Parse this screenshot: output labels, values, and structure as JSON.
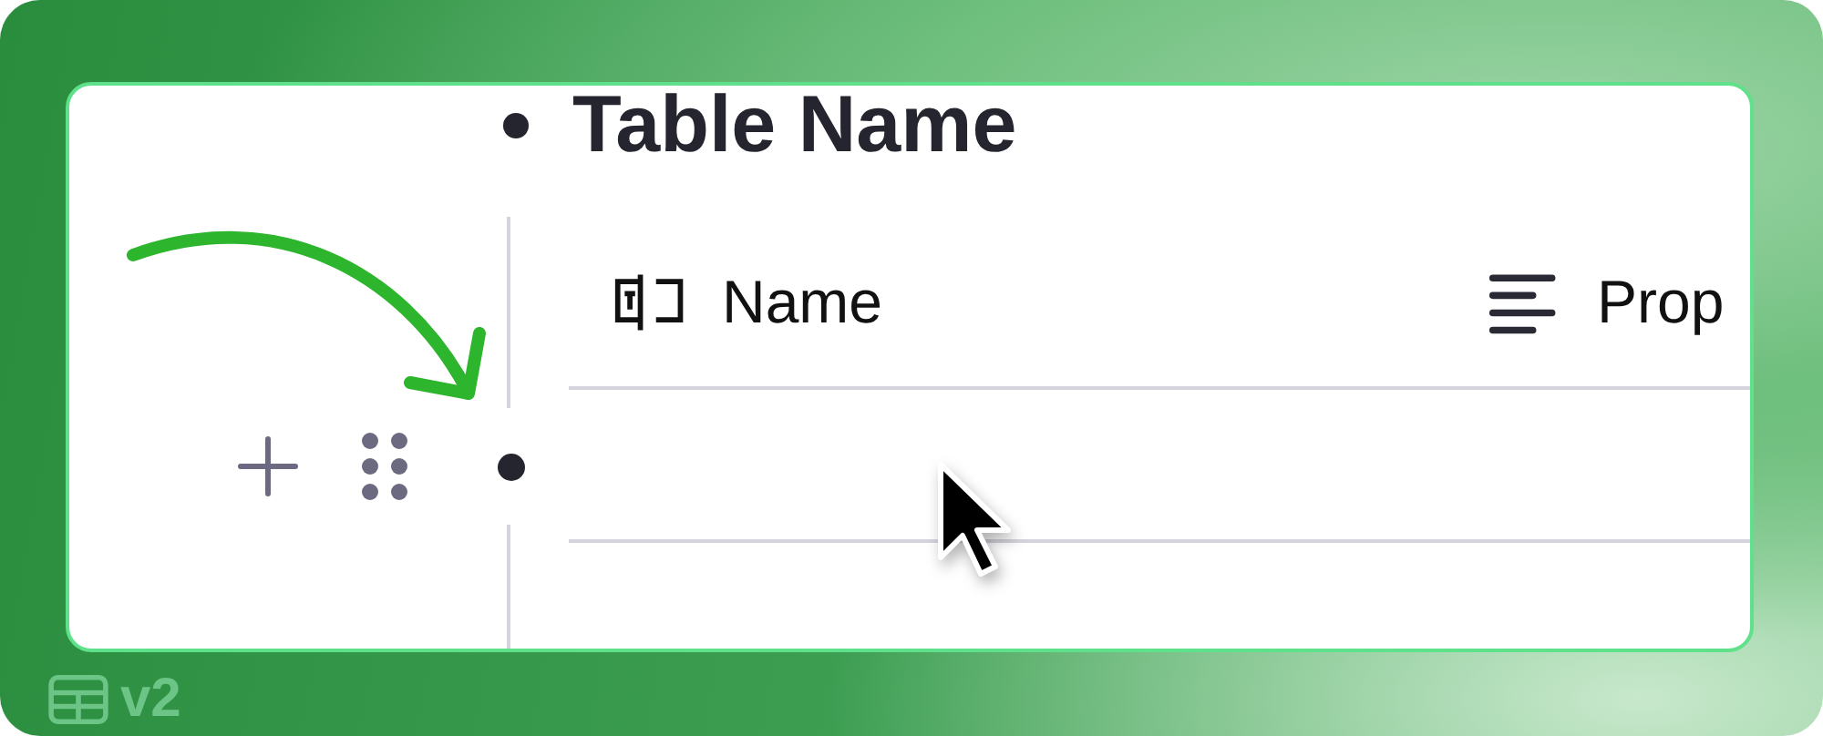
{
  "title": "Table Name",
  "columns": [
    {
      "label": "Name",
      "kind": "title"
    },
    {
      "label": "Prop",
      "kind": "text"
    }
  ],
  "version": "v2"
}
